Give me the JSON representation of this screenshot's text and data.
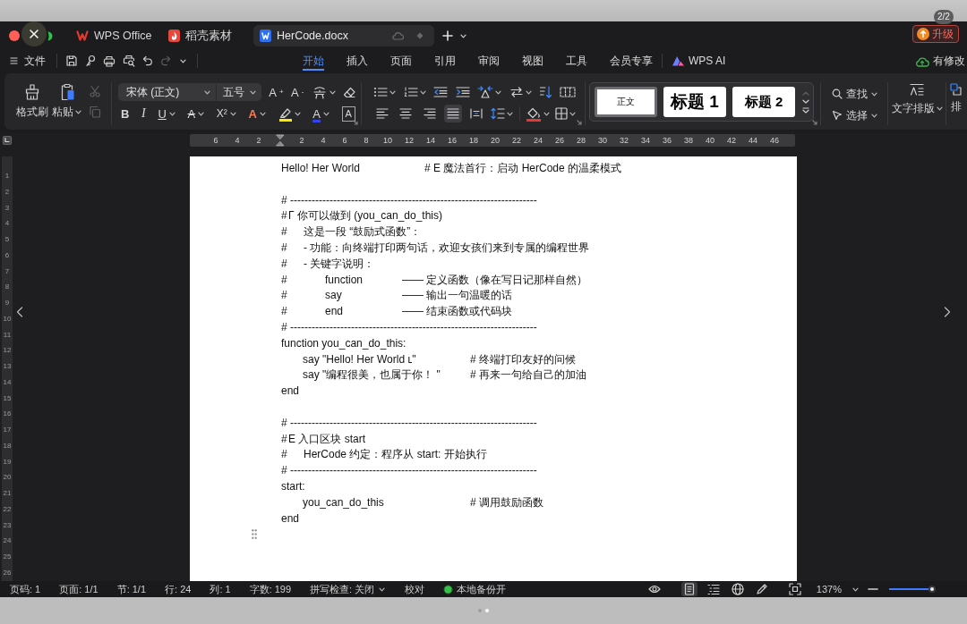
{
  "viewer": {
    "counter": "2/2",
    "pages": [
      {
        "selected": false
      },
      {
        "selected": true
      }
    ]
  },
  "window": {
    "tabs": [
      {
        "kind": "home",
        "label": "WPS Office",
        "selected": false
      },
      {
        "kind": "store",
        "label": "稻壳素材",
        "selected": false
      },
      {
        "kind": "document",
        "label": "HerCode.docx",
        "selected": true
      }
    ],
    "upgrade_button": "升级"
  },
  "menu": {
    "file": "文件",
    "quick_access": [
      {
        "kind": "save",
        "disabled": false
      },
      {
        "kind": "key",
        "disabled": false
      },
      {
        "kind": "print",
        "disabled": false
      },
      {
        "kind": "preview",
        "disabled": false
      },
      {
        "kind": "undo",
        "disabled": false
      },
      {
        "kind": "redo",
        "disabled": true
      }
    ],
    "tabs": [
      {
        "kind": "text",
        "label": "开始",
        "selected": true
      },
      {
        "kind": "text",
        "label": "插入",
        "selected": false
      },
      {
        "kind": "text",
        "label": "页面",
        "selected": false
      },
      {
        "kind": "text",
        "label": "引用",
        "selected": false
      },
      {
        "kind": "text",
        "label": "审阅",
        "selected": false
      },
      {
        "kind": "text",
        "label": "视图",
        "selected": false
      },
      {
        "kind": "text",
        "label": "工具",
        "selected": false
      },
      {
        "kind": "text",
        "label": "会员专享",
        "selected": false
      },
      {
        "kind": "ai",
        "label": "WPS AI",
        "selected": false
      }
    ],
    "save_status": "有修改"
  },
  "ribbon": {
    "clipboard": {
      "format_painter": "格式刷",
      "paste": "粘贴",
      "cut_disabled": true,
      "copy_disabled": true
    },
    "font": {
      "name": "宋体 (正文)",
      "size": "五号",
      "row1": [
        {
          "kind": "grow",
          "glyph": "A$^{+}$",
          "menu": false
        },
        {
          "kind": "shrink",
          "glyph": "A$^{-}$",
          "menu": false
        },
        {
          "kind": "phonetic",
          "menu": true
        },
        {
          "kind": "eraser",
          "menu": false
        }
      ],
      "row2": [
        {
          "kind": "bold",
          "glyph": "B",
          "menu": false
        },
        {
          "kind": "italic",
          "glyph": "I",
          "menu": false
        },
        {
          "kind": "underline",
          "glyph": "U",
          "menu": true
        },
        {
          "kind": "strike",
          "glyph": "A",
          "menu": true
        },
        {
          "kind": "superscript",
          "glyph": "X²",
          "menu": true
        },
        {
          "kind": "effect",
          "glyph": "A",
          "menu": true
        },
        {
          "kind": "highlight",
          "menu": true
        },
        {
          "kind": "color",
          "glyph": "A",
          "menu": true
        },
        {
          "kind": "border",
          "glyph": "A",
          "menu": false
        }
      ]
    },
    "paragraph": {
      "row1": [
        {
          "kind": "bullets",
          "menu": true
        },
        {
          "kind": "numbering",
          "menu": true
        },
        {
          "kind": "outdent",
          "menu": false
        },
        {
          "kind": "indent",
          "menu": false
        },
        {
          "kind": "spacing",
          "menu": true
        },
        {
          "kind": "swap",
          "menu": true
        },
        {
          "kind": "sort",
          "menu": false
        },
        {
          "kind": "gridlines",
          "menu": false
        }
      ],
      "align": [
        {
          "kind": "left",
          "selected": false
        },
        {
          "kind": "center",
          "selected": false
        },
        {
          "kind": "right",
          "selected": false
        },
        {
          "kind": "justify",
          "selected": true
        },
        {
          "kind": "distributed",
          "selected": false
        }
      ],
      "row2": [
        {
          "kind": "line_spacing",
          "menu": true
        },
        {
          "kind": "shading",
          "menu": true
        },
        {
          "kind": "borders",
          "menu": true
        }
      ]
    },
    "styles": [
      {
        "kind": "body",
        "label": "正文",
        "selected": true
      },
      {
        "kind": "heading1",
        "label": "标题 1",
        "selected": false
      },
      {
        "kind": "heading2",
        "label": "标题 2",
        "selected": false
      }
    ],
    "editing": {
      "find": "查找",
      "select": "选择"
    },
    "text_layout": "文字排版",
    "arrange": "排"
  },
  "ruler": {
    "left_ticks": [
      "6",
      "4",
      "2"
    ],
    "right_ticks": [
      "2",
      "4",
      "6",
      "8",
      "10",
      "12",
      "14",
      "16",
      "18",
      "20",
      "22",
      "24",
      "26",
      "28",
      "30",
      "32",
      "34",
      "36",
      "38",
      "40",
      "42",
      "44",
      "46"
    ]
  },
  "vertical_ruler": {
    "ticks": [
      "1",
      "2",
      "3",
      "4",
      "5",
      "6",
      "7",
      "8",
      "9",
      "10",
      "11",
      "12",
      "13",
      "14",
      "15",
      "16",
      "17",
      "18",
      "19",
      "20",
      "21",
      "22",
      "23",
      "24",
      "25",
      "26"
    ]
  },
  "document": {
    "lines": [
      {
        "kind": "code",
        "text": "Hello! Her World",
        "comment": "# E 魔法首行：启动 HerCode 的温柔模式"
      },
      {
        "kind": "blank"
      },
      {
        "kind": "rule",
        "text": "# ---------------------------------------------------------------------"
      },
      {
        "kind": "comment",
        "marker": "#",
        "text": "Γ 你可以做到 (you_can_do_this)",
        "children": [
          {
            "kind": "comment",
            "marker": "#",
            "text": "这是一段 “鼓励式函数”："
          },
          {
            "kind": "comment",
            "marker": "#",
            "text": "- 功能：向终端打印两句话，欢迎女孩们来到专属的编程世界"
          },
          {
            "kind": "comment",
            "marker": "#",
            "text": "- 关键字说明：",
            "children": [
              {
                "kind": "keyword",
                "marker": "#",
                "term": "function",
                "text": "—— 定义函数（像在写日记那样自然）"
              },
              {
                "kind": "keyword",
                "marker": "#",
                "term": "say",
                "text": "—— 输出一句温暖的话"
              },
              {
                "kind": "keyword",
                "marker": "#",
                "term": "end",
                "text": "—— 结束函数或代码块"
              }
            ]
          }
        ]
      },
      {
        "kind": "rule",
        "text": "# ---------------------------------------------------------------------"
      },
      {
        "kind": "code",
        "text": "function you_can_do_this:",
        "children": [
          {
            "kind": "code",
            "text": "say \"Hello! Her World ʟ\"",
            "comment": "# 终端打印友好的问候"
          },
          {
            "kind": "code",
            "text": "say \"编程很美，也属于你！ \"",
            "comment": "# 再来一句给自己的加油"
          }
        ]
      },
      {
        "kind": "code",
        "text": "end"
      },
      {
        "kind": "blank"
      },
      {
        "kind": "rule",
        "text": "# ---------------------------------------------------------------------"
      },
      {
        "kind": "comment",
        "marker": "#",
        "text": "E 入口区块 start",
        "children": [
          {
            "kind": "comment",
            "marker": "#",
            "text": "HerCode 约定：程序从 start: 开始执行"
          }
        ]
      },
      {
        "kind": "rule",
        "text": "# ---------------------------------------------------------------------"
      },
      {
        "kind": "code",
        "text": "start:",
        "children": [
          {
            "kind": "code",
            "text": "you_can_do_this",
            "comment": "# 调用鼓励函数"
          }
        ]
      },
      {
        "kind": "code",
        "text": "end"
      }
    ]
  },
  "status_bar": {
    "fields": [
      "页码: 1",
      "页面: 1/1",
      "节: 1/1",
      "行: 24",
      "列: 1",
      "字数: 199"
    ],
    "spell_check": "拼写检查: 关闭",
    "proofread": "校对",
    "backup": {
      "label": "本地备份开",
      "on": true
    },
    "views": [
      {
        "kind": "reading",
        "selected": false
      },
      {
        "kind": "page",
        "selected": true
      },
      {
        "kind": "outline",
        "selected": false
      },
      {
        "kind": "web",
        "selected": false
      },
      {
        "kind": "pen",
        "selected": false
      }
    ],
    "zoom": {
      "label": "137%",
      "level": 0.92
    }
  }
}
